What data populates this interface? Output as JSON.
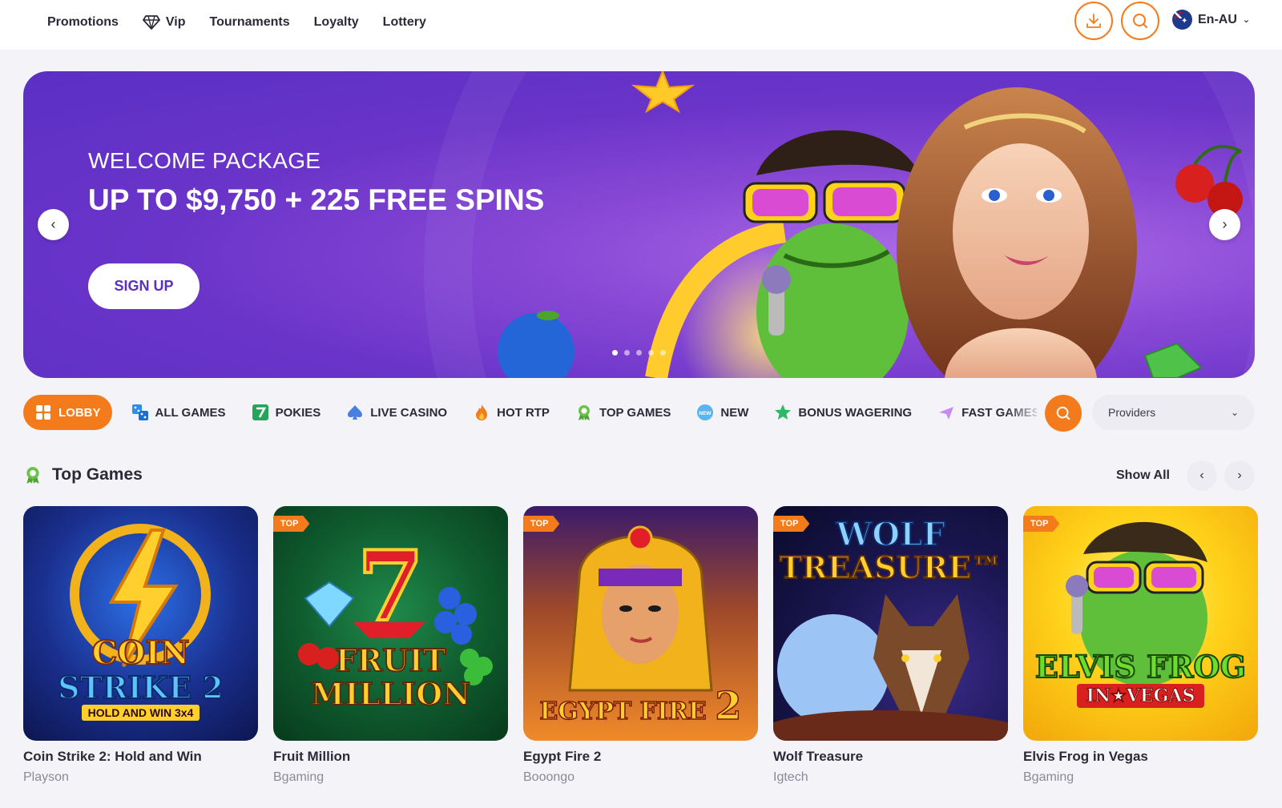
{
  "header": {
    "nav": [
      {
        "label": "Promotions"
      },
      {
        "label": "Vip"
      },
      {
        "label": "Tournaments"
      },
      {
        "label": "Loyalty"
      },
      {
        "label": "Lottery"
      }
    ],
    "language": "En-AU",
    "accent_color": "#f47b1c"
  },
  "banner": {
    "subtitle": "WELCOME PACKAGE",
    "title": "UP TO $9,750 + 225 FREE SPINS",
    "cta": "SIGN UP",
    "slides": 5,
    "active_slide": 1
  },
  "categories": [
    {
      "label": "LOBBY",
      "icon": "grid-icon",
      "active": true
    },
    {
      "label": "ALL GAMES",
      "icon": "dice-icon"
    },
    {
      "label": "POKIES",
      "icon": "seven-icon"
    },
    {
      "label": "LIVE CASINO",
      "icon": "spade-icon"
    },
    {
      "label": "HOT RTP",
      "icon": "flame-icon"
    },
    {
      "label": "TOP GAMES",
      "icon": "award-icon"
    },
    {
      "label": "NEW",
      "icon": "new-icon"
    },
    {
      "label": "BONUS WAGERING",
      "icon": "star-icon"
    },
    {
      "label": "FAST GAMES",
      "icon": "plane-icon"
    }
  ],
  "providers_select": "Providers",
  "section": {
    "title": "Top Games",
    "show_all": "Show All"
  },
  "games": [
    {
      "title": "Coin Strike 2: Hold and Win",
      "provider": "Playson",
      "badge": null,
      "art_line1": "COIN",
      "art_line2": "STRIKE 2",
      "art_line3": "HOLD AND WIN 3x4"
    },
    {
      "title": "Fruit Million",
      "provider": "Bgaming",
      "badge": "TOP",
      "art_line1": "7",
      "art_line2": "FRUIT",
      "art_line3": "MILLION"
    },
    {
      "title": "Egypt Fire 2",
      "provider": "Booongo",
      "badge": "TOP",
      "art_line1": "EGYPT FIRE",
      "art_line2": "2"
    },
    {
      "title": "Wolf Treasure",
      "provider": "Igtech",
      "badge": "TOP",
      "art_line1": "WOLF",
      "art_line2": "TREASURE™"
    },
    {
      "title": "Elvis Frog in Vegas",
      "provider": "Bgaming",
      "badge": "TOP",
      "art_line1": "ELVIS FROG",
      "art_line2": "IN★VEGAS"
    }
  ]
}
